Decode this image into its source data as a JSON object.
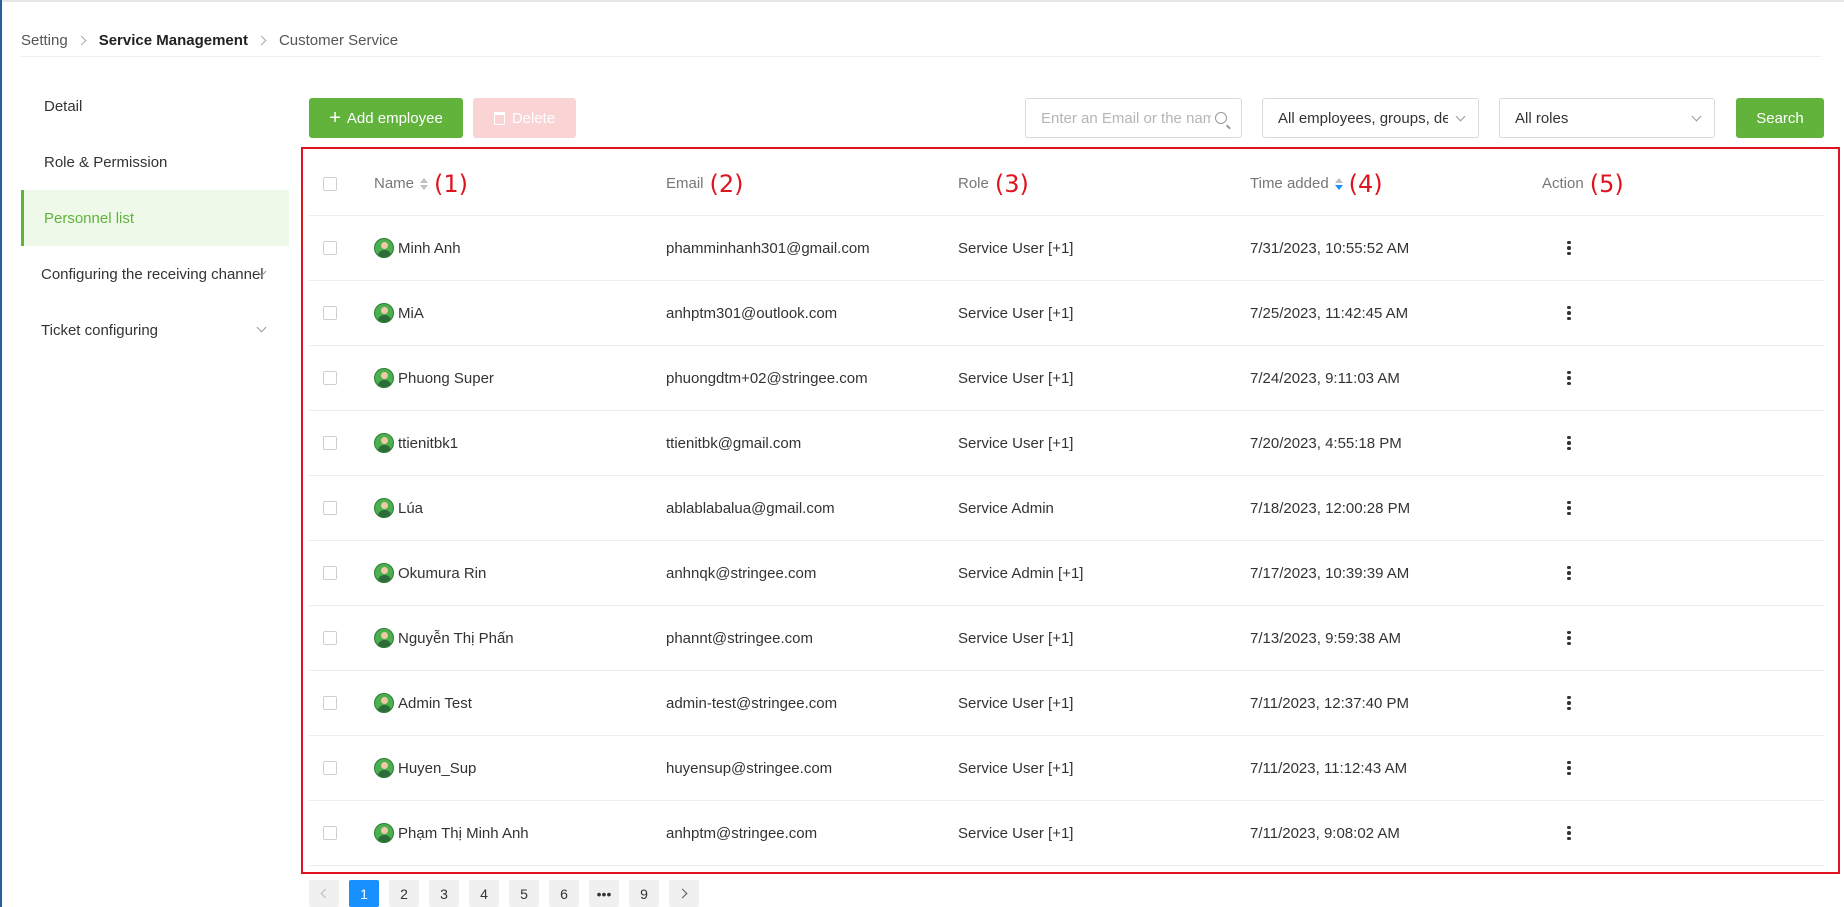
{
  "breadcrumb": {
    "items": [
      "Setting",
      "Service Management",
      "Customer Service"
    ]
  },
  "sidebar": {
    "items": [
      {
        "label": "Detail"
      },
      {
        "label": "Role & Permission"
      },
      {
        "label": "Personnel list",
        "active": true
      },
      {
        "label": "Configuring the receiving channel",
        "expandable": true
      },
      {
        "label": "Ticket configuring",
        "expandable": true
      }
    ]
  },
  "toolbar": {
    "add_label": "Add employee",
    "delete_label": "Delete",
    "search_placeholder": "Enter an Email or the name",
    "group_filter": "All employees, groups, departments",
    "role_filter": "All roles",
    "search_label": "Search"
  },
  "table": {
    "columns": [
      "Name",
      "Email",
      "Role",
      "Time added",
      "Action"
    ],
    "annotations": [
      "(1)",
      "(2)",
      "(3)",
      "(4)",
      "(5)"
    ],
    "rows": [
      {
        "name": "Minh Anh",
        "email": "phamminhanh301@gmail.com",
        "role": "Service User [+1]",
        "time": "7/31/2023, 10:55:52 AM"
      },
      {
        "name": "MiA",
        "email": "anhptm301@outlook.com",
        "role": "Service User [+1]",
        "time": "7/25/2023, 11:42:45 AM"
      },
      {
        "name": "Phuong Super",
        "email": "phuongdtm+02@stringee.com",
        "role": "Service User [+1]",
        "time": "7/24/2023, 9:11:03 AM"
      },
      {
        "name": "ttienitbk1",
        "email": "ttienitbk@gmail.com",
        "role": "Service User [+1]",
        "time": "7/20/2023, 4:55:18 PM"
      },
      {
        "name": "Lúa",
        "email": "ablablabalua@gmail.com",
        "role": "Service Admin",
        "time": "7/18/2023, 12:00:28 PM"
      },
      {
        "name": "Okumura Rin",
        "email": "anhnqk@stringee.com",
        "role": "Service Admin [+1]",
        "time": "7/17/2023, 10:39:39 AM"
      },
      {
        "name": "Nguyễn Thị Phấn",
        "email": "phannt@stringee.com",
        "role": "Service User [+1]",
        "time": "7/13/2023, 9:59:38 AM"
      },
      {
        "name": "Admin Test",
        "email": "admin-test@stringee.com",
        "role": "Service User [+1]",
        "time": "7/11/2023, 12:37:40 PM"
      },
      {
        "name": "Huyen_Sup",
        "email": "huyensup@stringee.com",
        "role": "Service User [+1]",
        "time": "7/11/2023, 11:12:43 AM"
      },
      {
        "name": "Phạm Thị Minh Anh",
        "email": "anhptm@stringee.com",
        "role": "Service User [+1]",
        "time": "7/11/2023, 9:08:02 AM"
      }
    ]
  },
  "pagination": {
    "pages": [
      "1",
      "2",
      "3",
      "4",
      "5",
      "6",
      "•••",
      "9"
    ],
    "current": "1"
  },
  "colors": {
    "accent": "#62b33c",
    "page_active": "#1890ff",
    "annotation": "#e0141e"
  }
}
